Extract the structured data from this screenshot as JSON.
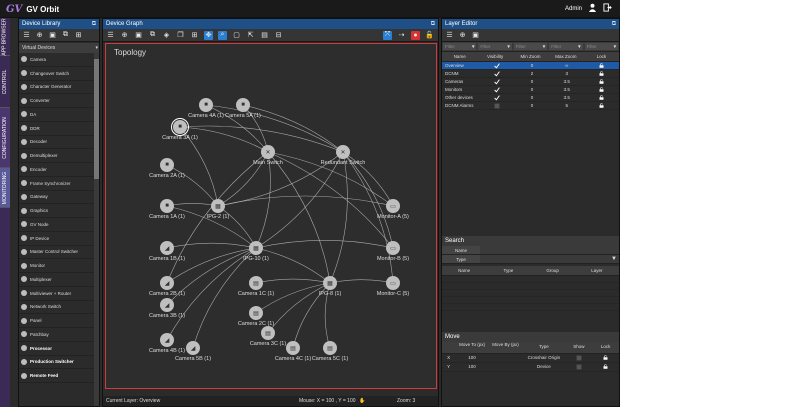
{
  "app": {
    "title": "GV Orbit",
    "user": "Admin"
  },
  "vtabs": [
    {
      "label": "APP BROWSER"
    },
    {
      "label": "CONTROL"
    },
    {
      "label": "CONFIGURATION"
    },
    {
      "label": "MONITORING"
    }
  ],
  "library": {
    "title": "Device Library",
    "section": "Virtual Devices",
    "items": [
      "Camera",
      "Changeover Switch",
      "Character Generator",
      "Converter",
      "DA",
      "DDR",
      "Decoder",
      "Demultiplexer",
      "Encoder",
      "Frame Synchronizer",
      "Gateway",
      "Graphics",
      "GV Node",
      "IP Device",
      "Master Control Switcher",
      "Monitor",
      "Multiplexer",
      "Multiviewer + Router",
      "Network Switch",
      "Panel",
      "Patchbay",
      "Processor",
      "Production Switcher",
      "Remote Feed"
    ]
  },
  "graph": {
    "title": "Device Graph",
    "topology_label": "Topology",
    "status": {
      "current_layer": "Current Layer: Overview",
      "mouse": "Mouse: X = 100 , Y = 100",
      "zoom": "Zoom: 3"
    },
    "nodes": [
      {
        "id": "cam4a",
        "label": "Camera 4A (1)",
        "kind": "camera"
      },
      {
        "id": "cam5a",
        "label": "Camera 5A (1)",
        "kind": "camera"
      },
      {
        "id": "cam3a",
        "label": "Camera 3A (1)",
        "kind": "camera"
      },
      {
        "id": "main",
        "label": "Main Switch",
        "kind": "switch"
      },
      {
        "id": "red",
        "label": "Redundant Switch",
        "kind": "switch"
      },
      {
        "id": "cam2a",
        "label": "Camera 2A (1)",
        "kind": "camera"
      },
      {
        "id": "cam1a",
        "label": "Camera 1A (1)",
        "kind": "camera"
      },
      {
        "id": "ipg2",
        "label": "IPG-2 (1)",
        "kind": "gateway"
      },
      {
        "id": "mona",
        "label": "Monitor-A (5)",
        "kind": "monitor"
      },
      {
        "id": "cam1b",
        "label": "Camera 1B (1)",
        "kind": "camerab"
      },
      {
        "id": "ipg10",
        "label": "IPG-10 (1)",
        "kind": "gateway"
      },
      {
        "id": "monb",
        "label": "Monitor-B (5)",
        "kind": "monitor"
      },
      {
        "id": "cam2b",
        "label": "Camera 2B (1)",
        "kind": "camerab"
      },
      {
        "id": "cam1c",
        "label": "Camera 1C (1)",
        "kind": "camerac"
      },
      {
        "id": "ipg8",
        "label": "IPG-8 (1)",
        "kind": "gateway"
      },
      {
        "id": "monc",
        "label": "Monitor-C (5)",
        "kind": "monitor"
      },
      {
        "id": "cam3b",
        "label": "Camera 3B (1)",
        "kind": "camerab"
      },
      {
        "id": "cam2c",
        "label": "Camera 2C (1)",
        "kind": "camerac"
      },
      {
        "id": "cam4b",
        "label": "Camera 4B (1)",
        "kind": "camerab"
      },
      {
        "id": "cam3c",
        "label": "Camera 3C (1)",
        "kind": "camerac"
      },
      {
        "id": "cam5b",
        "label": "Camera 5B (1)",
        "kind": "camerab"
      },
      {
        "id": "cam4c",
        "label": "Camera 4C (1)",
        "kind": "camerac"
      },
      {
        "id": "cam5c",
        "label": "Camera 5C (1)",
        "kind": "camerac"
      }
    ]
  },
  "layers": {
    "title": "Layer Editor",
    "filter_placeholder": "Filter",
    "columns": [
      "Name",
      "Visibility",
      "Min Zoom",
      "Max Zoom",
      "Lock"
    ],
    "rows": [
      {
        "name": "Overview",
        "visible": true,
        "min": "0",
        "max": "∞",
        "selected": true
      },
      {
        "name": "DCNM",
        "visible": true,
        "min": "2",
        "max": "3",
        "selected": false
      },
      {
        "name": "Cameras",
        "visible": true,
        "min": "0",
        "max": "3.5",
        "selected": false
      },
      {
        "name": "Monitors",
        "visible": true,
        "min": "0",
        "max": "3.5",
        "selected": false
      },
      {
        "name": "Other devices",
        "visible": true,
        "min": "0",
        "max": "3.5",
        "selected": false
      },
      {
        "name": "DCNM Alarms",
        "visible": false,
        "min": "0",
        "max": "5",
        "selected": false
      }
    ]
  },
  "search": {
    "title": "Search",
    "fields": [
      "Name",
      "Type"
    ],
    "columns": [
      "Name",
      "Type",
      "Group",
      "Layer"
    ]
  },
  "move": {
    "title": "Move",
    "columns": [
      "Move To (px)",
      "Move By (px)",
      "Type",
      "Show",
      "Lock"
    ],
    "rows": [
      {
        "axis": "X",
        "to": "100",
        "by": "",
        "type": "Crosshair Origin"
      },
      {
        "axis": "Y",
        "to": "100",
        "by": "",
        "type": "Device"
      }
    ]
  }
}
